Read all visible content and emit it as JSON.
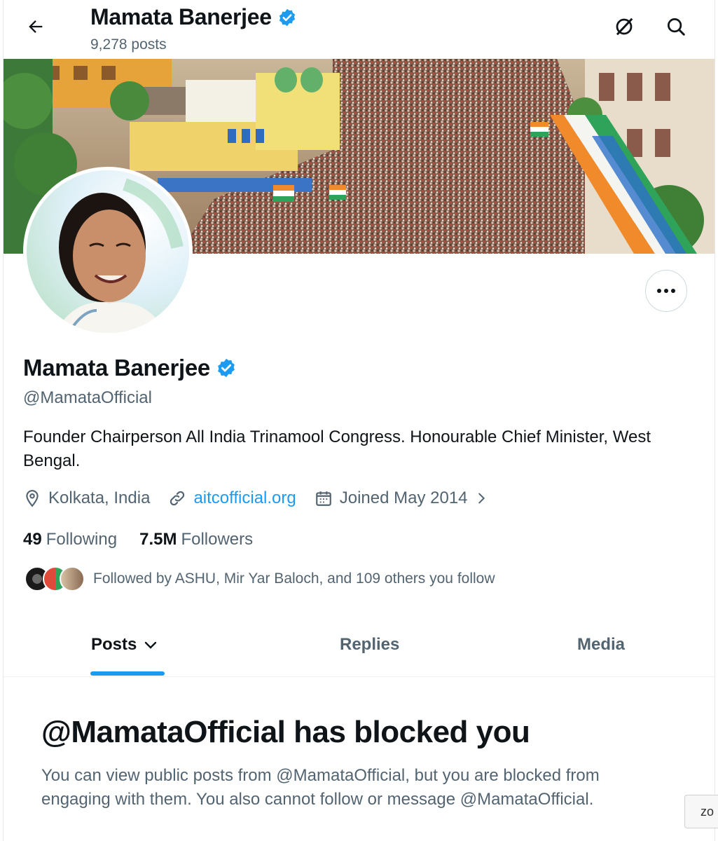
{
  "header": {
    "title": "Mamata Banerjee",
    "post_count": "9,278 posts"
  },
  "profile": {
    "name": "Mamata Banerjee",
    "handle": "@MamataOfficial",
    "bio": "Founder Chairperson All India Trinamool Congress. Honourable Chief Minister, West Bengal.",
    "location": "Kolkata, India",
    "website": "aitcofficial.org",
    "joined": "Joined May 2014",
    "following_count": "49",
    "following_label": "Following",
    "followers_count": "7.5M",
    "followers_label": "Followers",
    "followed_by": "Followed by ASHU, Mir Yar Baloch, and 109 others you follow"
  },
  "tabs": [
    {
      "label": "Posts",
      "active": true
    },
    {
      "label": "Replies",
      "active": false
    },
    {
      "label": "Media",
      "active": false
    }
  ],
  "blocked": {
    "title": "@MamataOfficial has blocked you",
    "message": "You can view public posts from @MamataOfficial, but you are blocked from engaging with them. You also cannot follow or message @MamataOfficial."
  },
  "zoom_chip": "zo",
  "colors": {
    "accent": "#1d9bf0",
    "text_primary": "#0f1419",
    "text_secondary": "#536471",
    "verified": "#1d9bf0"
  },
  "icons": {
    "back": "arrow-left-icon",
    "grok": "grok-icon",
    "search": "search-icon",
    "more": "more-horizontal-icon",
    "location": "location-pin-icon",
    "link": "link-icon",
    "calendar": "calendar-icon",
    "verified": "verified-badge-icon"
  }
}
